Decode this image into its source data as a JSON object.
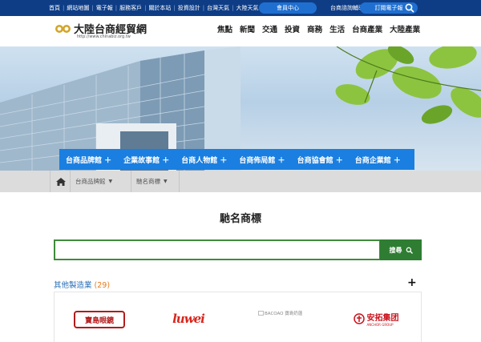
{
  "topbar": {
    "links": [
      "首頁",
      "網站地圖",
      "電子報",
      "服務客戶",
      "關於本站",
      "投資設計",
      "台灣天氣",
      "大陸天氣"
    ],
    "member_label": "會員中心",
    "help_label": "台商諮詢輔導",
    "subscribe_label": "訂閱電子報"
  },
  "header": {
    "site_title": "大陸台商經貿網",
    "site_url": "http://www.chinabiz.org.tw",
    "nav": [
      "焦點",
      "新聞",
      "交通",
      "投資",
      "商務",
      "生活",
      "台商產業",
      "大陸產業"
    ]
  },
  "category_nav": [
    "台商品牌館 ＋",
    "企業故事館 ＋",
    "台商人物館 ＋",
    "台商佈局館 ＋",
    "台商協會館 ＋",
    "台商企業館 ＋"
  ],
  "breadcrumb": {
    "items": [
      "台商品牌館",
      "馳名商標"
    ]
  },
  "main": {
    "title": "馳名商標",
    "search_value": "",
    "search_button": "搜尋",
    "category_name": "其他製造業",
    "category_count": "(29)",
    "brands": [
      {
        "name": "寶島眼鏡"
      },
      {
        "name": "luwei"
      },
      {
        "name": "BACOAO 寶島奶蓮"
      },
      {
        "name": "安拓集团",
        "sub": "ANCHOR GROUP"
      }
    ]
  },
  "colors": {
    "topbar": "#0e3d86",
    "category_nav": "#1a7fe0",
    "search_green": "#2e7d32",
    "count_orange": "#e67a1a"
  }
}
